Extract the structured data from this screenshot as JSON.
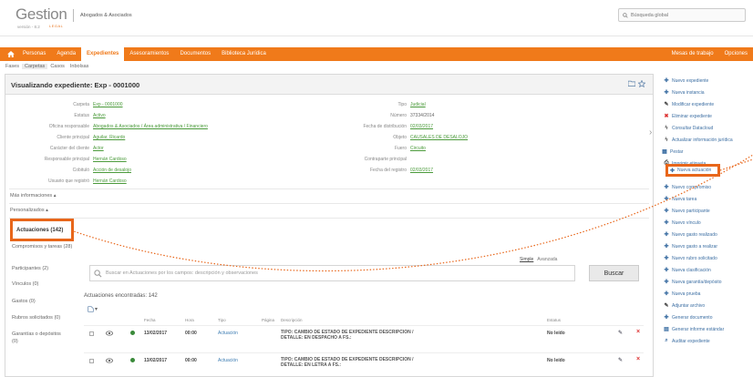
{
  "header": {
    "logo_text": "Gestion",
    "logo_sub": "LEGAL",
    "version": "versión - 8.2",
    "company": "Abogados & Asociados",
    "search_placeholder": "Búsqueda global"
  },
  "nav": {
    "items": [
      "Personas",
      "Agenda",
      "Expedientes",
      "Asesoramientos",
      "Documentos",
      "Biblioteca Jurídica"
    ],
    "active_index": 2,
    "right_items": [
      "Mesas de trabajo",
      "Opciones"
    ]
  },
  "subnav": {
    "items": [
      "Fases",
      "Carpetas",
      "Casos",
      "Inbolsas"
    ],
    "active_index": 1
  },
  "panel": {
    "title": "Visualizando expediente: Exp - 0001000",
    "left_fields": [
      {
        "label": "Carpeta",
        "value": "Exp - 0001000",
        "link": true
      },
      {
        "label": "Estatus",
        "value": "Activo",
        "link": true
      },
      {
        "label": "Oficina responsable",
        "value": "Abogados & Asociados / Área administrativa / Financiero",
        "link": true
      },
      {
        "label": "Cliente principal",
        "value": "Aguilar, Ricardo",
        "link": true
      },
      {
        "label": "Carácter del cliente",
        "value": "Actor",
        "link": true
      },
      {
        "label": "Responsable principal",
        "value": "Hernán Cardoso",
        "link": true
      },
      {
        "label": "Cobituló",
        "value": "Acción de desalojo",
        "link": true
      },
      {
        "label": "Usuario que registró",
        "value": "Hernán Cardoso",
        "link": true
      }
    ],
    "right_fields": [
      {
        "label": "Tipo",
        "value": "Judicial",
        "link": true
      },
      {
        "label": "Número",
        "value": "37334/2014",
        "link": false
      },
      {
        "label": "Fecha de distribución",
        "value": "02/03/2017",
        "link": true
      },
      {
        "label": "Objeto",
        "value": "CAUSALES DE DESALOJO",
        "link": true
      },
      {
        "label": "Fuero",
        "value": "Circuito",
        "link": true
      },
      {
        "label": "Contraparte principal",
        "value": "",
        "link": false
      },
      {
        "label": "Fecha del registro",
        "value": "02/03/2017",
        "link": true
      }
    ],
    "more_info": "Más informaciones",
    "personalized": "Personalizados"
  },
  "subside": {
    "active": "Actuaciones (142)",
    "items": [
      "Compromisos y tareas (28)",
      "Participantes (2)",
      "Vínculos (0)",
      "Gastos (0)",
      "Rubros solicitados (0)",
      "Garantías o depósitos (0)"
    ]
  },
  "actuaciones": {
    "tab_simple": "Simple",
    "tab_advanced": "Avanzada",
    "search_placeholder": "Buscar en Actuaciones por los campos: descripción y observaciones",
    "search_button": "Buscar",
    "count_text": "Actuaciones encontradas: 142",
    "columns": [
      "Fecha",
      "Hora",
      "Tipo",
      "Página",
      "Descripción",
      "Estatus"
    ],
    "rows": [
      {
        "fecha": "13/02/2017",
        "hora": "00:00",
        "tipo": "Actuación",
        "descripcion": "TIPO: CAMBIO DE ESTADO DE EXPEDIENTE DESCRIPCION / DETALLE: EN DESPACHO A FS.:",
        "estatus": "No leído"
      },
      {
        "fecha": "13/02/2017",
        "hora": "00:00",
        "tipo": "Actuación",
        "descripcion": "TIPO: CAMBIO DE ESTADO DE EXPEDIENTE DESCRIPCION / DETALLE: EN LETRA A FS.:",
        "estatus": "No leído"
      }
    ]
  },
  "actions": [
    {
      "label": "Nuevo expediente",
      "icon": "plus"
    },
    {
      "label": "Nueva instancia",
      "icon": "plus"
    },
    {
      "label": "Modificar expediente",
      "icon": "pencil"
    },
    {
      "label": "Eliminar expediente",
      "icon": "x"
    },
    {
      "label": "Consultar Datacloud",
      "icon": "bolt"
    },
    {
      "label": "Actualizar información jurídica",
      "icon": "bolt"
    },
    {
      "label": "Pestar",
      "icon": "book"
    },
    {
      "label": "Imprimir etiqueta",
      "icon": "print"
    },
    {
      "label": "Nueva actuación",
      "icon": "plus"
    },
    {
      "label": "Nuevo compromiso",
      "icon": "plus"
    },
    {
      "label": "Nueva tarea",
      "icon": "plus"
    },
    {
      "label": "Nuevo participante",
      "icon": "plus"
    },
    {
      "label": "Nuevo vínculo",
      "icon": "plus"
    },
    {
      "label": "Nuevo gasto realizado",
      "icon": "plus"
    },
    {
      "label": "Nuevo gasto a realizar",
      "icon": "plus"
    },
    {
      "label": "Nuevo rubro solicitado",
      "icon": "plus"
    },
    {
      "label": "Nueva clasificación",
      "icon": "plus"
    },
    {
      "label": "Nueva garantía/depósito",
      "icon": "plus"
    },
    {
      "label": "Nueva prueba",
      "icon": "plus"
    },
    {
      "label": "Adjuntar archivo",
      "icon": "pencil"
    },
    {
      "label": "Generar documento",
      "icon": "plus"
    },
    {
      "label": "Generar informe estándar",
      "icon": "doc"
    },
    {
      "label": "Auditar expediente",
      "icon": "search"
    }
  ],
  "colors": {
    "accent": "#f07a1a",
    "highlight": "#e8661a",
    "link_green": "#4a9a3a",
    "link_blue": "#3d6fa3"
  }
}
